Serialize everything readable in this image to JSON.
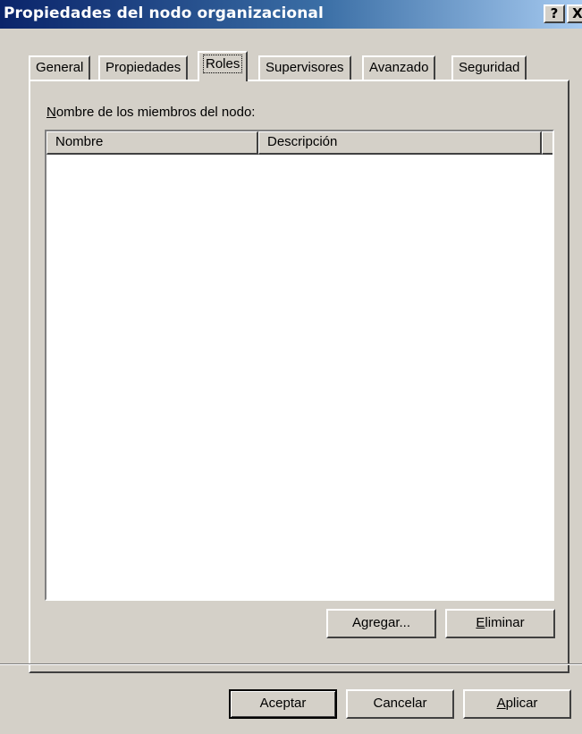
{
  "window": {
    "title": "Propiedades del nodo organizacional",
    "help_glyph": "?",
    "close_glyph": "X"
  },
  "tabs": [
    {
      "label": "General",
      "active": false
    },
    {
      "label": "Propiedades",
      "active": false
    },
    {
      "label": "Roles",
      "active": true
    },
    {
      "label": "Supervisores",
      "active": false
    },
    {
      "label": "Avanzado",
      "active": false
    },
    {
      "label": "Seguridad",
      "active": false
    }
  ],
  "roles": {
    "list_label_mnemonic": "N",
    "list_label_rest": "ombre de los miembros del nodo:",
    "columns": [
      "Nombre",
      "Descripción"
    ],
    "rows": [],
    "add_button": "Agregar...",
    "remove_mnemonic": "E",
    "remove_rest": "liminar"
  },
  "footer": {
    "ok": "Aceptar",
    "cancel": "Cancelar",
    "apply_mnemonic": "A",
    "apply_rest": "plicar"
  }
}
